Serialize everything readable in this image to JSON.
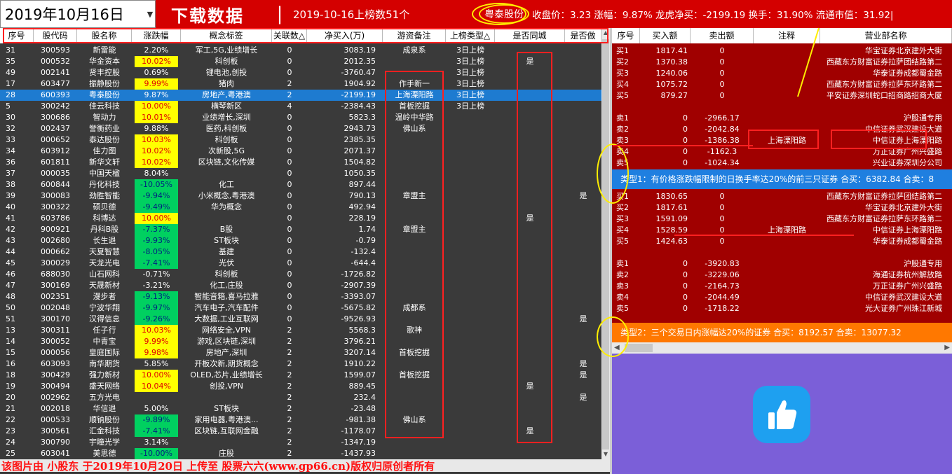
{
  "top": {
    "date": "2019年10月16日",
    "download_label": "下载数据",
    "separator": "|",
    "date_count": "2019-10-16上榜数51个",
    "separator2": "|",
    "stock_name": "粤泰股份",
    "quote": "收盘价：3.23 涨幅：9.87% 龙虎净买：-2199.19 换手：31.90% 流通市值：31.92|"
  },
  "left_table": {
    "headers": [
      "序号",
      "股代码",
      "股名称",
      "涨跌幅",
      "概念标签",
      "关联数△",
      "净买入(万)",
      "游资备注",
      "上榜类型△",
      "是否同城",
      "是否做"
    ],
    "rows": [
      {
        "seq": "31",
        "code": "300593",
        "name": "新雷能",
        "chg": "2.20%",
        "hl": "",
        "concept": "军工,5G,业绩增长",
        "link": "0",
        "net": "3083.19",
        "note": "成泉系",
        "type": "3日上榜",
        "city": "",
        "do": ""
      },
      {
        "seq": "35",
        "code": "000532",
        "name": "华金资本",
        "chg": "10.02%",
        "hl": "y",
        "concept": "科创板",
        "link": "0",
        "net": "2012.35",
        "note": "",
        "type": "3日上榜",
        "city": "是",
        "do": ""
      },
      {
        "seq": "49",
        "code": "002141",
        "name": "贤丰控股",
        "chg": "0.69%",
        "hl": "",
        "concept": "锂电池,创投",
        "link": "0",
        "net": "-3760.47",
        "note": "",
        "type": "3日上榜",
        "city": "",
        "do": ""
      },
      {
        "seq": "17",
        "code": "603477",
        "name": "振静股份",
        "chg": "9.99%",
        "hl": "y",
        "concept": "猪肉",
        "link": "2",
        "net": "1904.92",
        "note": "作手新一",
        "type": "3日上榜",
        "city": "",
        "do": ""
      },
      {
        "seq": "28",
        "code": "600393",
        "name": "粤泰股份",
        "chg": "9.87%",
        "hl": "",
        "concept": "房地产,粤港澳",
        "link": "2",
        "net": "-2199.19",
        "note": "上海溧阳路",
        "type": "3日上榜",
        "city": "",
        "do": "",
        "sel": true
      },
      {
        "seq": "5",
        "code": "300242",
        "name": "佳云科技",
        "chg": "10.00%",
        "hl": "y",
        "concept": "横琴新区",
        "link": "4",
        "net": "-2384.43",
        "note": "首板挖掘",
        "type": "3日上榜",
        "city": "",
        "do": ""
      },
      {
        "seq": "30",
        "code": "300686",
        "name": "智动力",
        "chg": "10.01%",
        "hl": "y",
        "concept": "业绩增长,深圳",
        "link": "0",
        "net": "5823.3",
        "note": "温岭中华路",
        "type": "",
        "city": "",
        "do": ""
      },
      {
        "seq": "32",
        "code": "002437",
        "name": "誉衡药业",
        "chg": "9.88%",
        "hl": "",
        "concept": "医药,科创板",
        "link": "0",
        "net": "2943.73",
        "note": "佛山系",
        "type": "",
        "city": "",
        "do": ""
      },
      {
        "seq": "33",
        "code": "000652",
        "name": "泰达股份",
        "chg": "10.03%",
        "hl": "y",
        "concept": "科创板",
        "link": "0",
        "net": "2385.35",
        "note": "",
        "type": "",
        "city": "",
        "do": ""
      },
      {
        "seq": "34",
        "code": "603912",
        "name": "佳力图",
        "chg": "10.02%",
        "hl": "y",
        "concept": "次新股,5G",
        "link": "0",
        "net": "2071.37",
        "note": "",
        "type": "",
        "city": "",
        "do": ""
      },
      {
        "seq": "36",
        "code": "601811",
        "name": "新华文轩",
        "chg": "10.02%",
        "hl": "y",
        "concept": "区块链,文化传媒",
        "link": "0",
        "net": "1504.82",
        "note": "",
        "type": "",
        "city": "",
        "do": ""
      },
      {
        "seq": "37",
        "code": "000035",
        "name": "中国天楹",
        "chg": "8.04%",
        "hl": "",
        "concept": "",
        "link": "0",
        "net": "1050.35",
        "note": "",
        "type": "",
        "city": "",
        "do": ""
      },
      {
        "seq": "38",
        "code": "600844",
        "name": "丹化科技",
        "chg": "-10.05%",
        "hl": "g",
        "concept": "化工",
        "link": "0",
        "net": "897.44",
        "note": "",
        "type": "",
        "city": "",
        "do": ""
      },
      {
        "seq": "39",
        "code": "300083",
        "name": "劲胜智能",
        "chg": "-9.94%",
        "hl": "g",
        "concept": "小米概念,粤港澳",
        "link": "0",
        "net": "790.13",
        "note": "章盟主",
        "type": "",
        "city": "",
        "do": "是"
      },
      {
        "seq": "40",
        "code": "300322",
        "name": "硕贝德",
        "chg": "-9.49%",
        "hl": "g",
        "concept": "华为概念",
        "link": "0",
        "net": "492.94",
        "note": "",
        "type": "",
        "city": "",
        "do": ""
      },
      {
        "seq": "41",
        "code": "603786",
        "name": "科博达",
        "chg": "10.00%",
        "hl": "y",
        "concept": "",
        "link": "0",
        "net": "228.19",
        "note": "",
        "type": "",
        "city": "是",
        "do": ""
      },
      {
        "seq": "42",
        "code": "900921",
        "name": "丹科B股",
        "chg": "-7.37%",
        "hl": "g",
        "concept": "B股",
        "link": "0",
        "net": "1.74",
        "note": "章盟主",
        "type": "",
        "city": "",
        "do": ""
      },
      {
        "seq": "43",
        "code": "002680",
        "name": "长生退",
        "chg": "-9.93%",
        "hl": "g",
        "concept": "ST板块",
        "link": "0",
        "net": "-0.79",
        "note": "",
        "type": "",
        "city": "",
        "do": ""
      },
      {
        "seq": "44",
        "code": "000662",
        "name": "天夏智慧",
        "chg": "-8.05%",
        "hl": "g",
        "concept": "基建",
        "link": "0",
        "net": "-132.4",
        "note": "",
        "type": "",
        "city": "",
        "do": ""
      },
      {
        "seq": "45",
        "code": "300029",
        "name": "天龙光电",
        "chg": "-7.41%",
        "hl": "g",
        "concept": "光伏",
        "link": "0",
        "net": "-644.4",
        "note": "",
        "type": "",
        "city": "",
        "do": ""
      },
      {
        "seq": "46",
        "code": "688030",
        "name": "山石网科",
        "chg": "-0.71%",
        "hl": "",
        "concept": "科创板",
        "link": "0",
        "net": "-1726.82",
        "note": "",
        "type": "",
        "city": "",
        "do": ""
      },
      {
        "seq": "47",
        "code": "300169",
        "name": "天晟新材",
        "chg": "-3.21%",
        "hl": "",
        "concept": "化工,庄股",
        "link": "0",
        "net": "-2907.39",
        "note": "",
        "type": "",
        "city": "",
        "do": ""
      },
      {
        "seq": "48",
        "code": "002351",
        "name": "漫步者",
        "chg": "-9.13%",
        "hl": "g",
        "concept": "智能音箱,喜马拉雅",
        "link": "0",
        "net": "-3393.07",
        "note": "",
        "type": "",
        "city": "",
        "do": ""
      },
      {
        "seq": "50",
        "code": "002048",
        "name": "宁波华翔",
        "chg": "-9.97%",
        "hl": "g",
        "concept": "汽车电子,汽车配件",
        "link": "0",
        "net": "-5675.82",
        "note": "成都系",
        "type": "",
        "city": "",
        "do": ""
      },
      {
        "seq": "51",
        "code": "300170",
        "name": "汉得信息",
        "chg": "-9.26%",
        "hl": "g",
        "concept": "大数据,工业互联网",
        "link": "0",
        "net": "-9526.93",
        "note": "",
        "type": "",
        "city": "",
        "do": "是"
      },
      {
        "seq": "13",
        "code": "300311",
        "name": "任子行",
        "chg": "10.03%",
        "hl": "y",
        "concept": "网络安全,VPN",
        "link": "2",
        "net": "5568.3",
        "note": "歌神",
        "type": "",
        "city": "",
        "do": ""
      },
      {
        "seq": "14",
        "code": "300052",
        "name": "中青宝",
        "chg": "9.99%",
        "hl": "y",
        "concept": "游戏,区块链,深圳",
        "link": "2",
        "net": "3796.21",
        "note": "",
        "type": "",
        "city": "",
        "do": ""
      },
      {
        "seq": "15",
        "code": "000056",
        "name": "皇庭国际",
        "chg": "9.98%",
        "hl": "y",
        "concept": "房地产,深圳",
        "link": "2",
        "net": "3207.14",
        "note": "首板挖掘",
        "type": "",
        "city": "",
        "do": ""
      },
      {
        "seq": "16",
        "code": "603093",
        "name": "南华期货",
        "chg": "5.85%",
        "hl": "",
        "concept": "开板次新,期货概念",
        "link": "2",
        "net": "1910.22",
        "note": "",
        "type": "",
        "city": "",
        "do": "是"
      },
      {
        "seq": "18",
        "code": "300429",
        "name": "强力新材",
        "chg": "10.00%",
        "hl": "y",
        "concept": "OLED,芯片,业绩增长",
        "link": "2",
        "net": "1599.07",
        "note": "首板挖掘",
        "type": "",
        "city": "",
        "do": "是"
      },
      {
        "seq": "19",
        "code": "300494",
        "name": "盛天网络",
        "chg": "10.04%",
        "hl": "y",
        "concept": "创投,VPN",
        "link": "2",
        "net": "889.45",
        "note": "",
        "type": "",
        "city": "是",
        "do": ""
      },
      {
        "seq": "20",
        "code": "002962",
        "name": "五方光电",
        "chg": "",
        "hl": "",
        "concept": "",
        "link": "2",
        "net": "232.4",
        "note": "",
        "type": "",
        "city": "",
        "do": "是"
      },
      {
        "seq": "21",
        "code": "002018",
        "name": "华信退",
        "chg": "5.00%",
        "hl": "",
        "concept": "ST板块",
        "link": "2",
        "net": "-23.48",
        "note": "",
        "type": "",
        "city": "",
        "do": ""
      },
      {
        "seq": "22",
        "code": "000533",
        "name": "顺钠股份",
        "chg": "-9.89%",
        "hl": "g",
        "concept": "家用电器,粤港澳...",
        "link": "2",
        "net": "-981.38",
        "note": "佛山系",
        "type": "",
        "city": "",
        "do": ""
      },
      {
        "seq": "23",
        "code": "300561",
        "name": "汇金科技",
        "chg": "-7.41%",
        "hl": "g",
        "concept": "区块链,互联网金融",
        "link": "2",
        "net": "-1178.07",
        "note": "",
        "type": "",
        "city": "是",
        "do": ""
      },
      {
        "seq": "24",
        "code": "300790",
        "name": "宇瞳光学",
        "chg": "3.14%",
        "hl": "",
        "concept": "",
        "link": "2",
        "net": "-1347.19",
        "note": "",
        "type": "",
        "city": "",
        "do": ""
      },
      {
        "seq": "25",
        "code": "603041",
        "name": "美思德",
        "chg": "-10.00%",
        "hl": "g",
        "concept": "庄股",
        "link": "2",
        "net": "-1437.93",
        "note": "",
        "type": "",
        "city": "",
        "do": ""
      }
    ]
  },
  "right_table": {
    "headers": [
      "序号",
      "买入额",
      "卖出额",
      "注释",
      "营业部名称"
    ],
    "group1": [
      {
        "seq": "买1",
        "buy": "1817.41",
        "sell": "0",
        "note": "",
        "dept": "华宝证券北京建外大街"
      },
      {
        "seq": "买2",
        "buy": "1370.38",
        "sell": "0",
        "note": "",
        "dept": "西藏东方财富证券拉萨团结路第二"
      },
      {
        "seq": "买3",
        "buy": "1240.06",
        "sell": "0",
        "note": "",
        "dept": "华泰证券成都蜀金路"
      },
      {
        "seq": "买4",
        "buy": "1075.72",
        "sell": "0",
        "note": "",
        "dept": "西藏东方财富证券拉萨东环路第二"
      },
      {
        "seq": "买5",
        "buy": "879.27",
        "sell": "0",
        "note": "",
        "dept": "平安证券深圳蛇口招商路招商大厦"
      }
    ],
    "group2": [
      {
        "seq": "卖1",
        "buy": "0",
        "sell": "-2966.17",
        "note": "",
        "dept": "沪股通专用"
      },
      {
        "seq": "卖2",
        "buy": "0",
        "sell": "-2042.84",
        "note": "",
        "dept": "中信证券武汉建设大道"
      },
      {
        "seq": "卖3",
        "buy": "0",
        "sell": "-1386.38",
        "note": "上海溧阳路",
        "dept": "中信证券上海溧阳路"
      },
      {
        "seq": "卖4",
        "buy": "0",
        "sell": "-1162.3",
        "note": "",
        "dept": "万正证券广州兴盛路"
      },
      {
        "seq": "卖5",
        "buy": "0",
        "sell": "-1024.34",
        "note": "",
        "dept": "兴业证券深圳分公司"
      }
    ],
    "band1": "类型1：有价格涨跌幅限制的日换手率达20%的前三只证券 合买：6382.84 合卖：8",
    "group3": [
      {
        "seq": "买1",
        "buy": "1830.65",
        "sell": "0",
        "note": "",
        "dept": "西藏东方财富证券拉萨团结路第二"
      },
      {
        "seq": "买2",
        "buy": "1817.61",
        "sell": "0",
        "note": "",
        "dept": "华宝证券北京建外大街"
      },
      {
        "seq": "买3",
        "buy": "1591.09",
        "sell": "0",
        "note": "",
        "dept": "西藏东方财富证券拉萨东环路第二"
      },
      {
        "seq": "买4",
        "buy": "1528.59",
        "sell": "0",
        "note": "上海溧阳路",
        "dept": "中信证券上海溧阳路"
      },
      {
        "seq": "买5",
        "buy": "1424.63",
        "sell": "0",
        "note": "",
        "dept": "华泰证券成都蜀金路"
      }
    ],
    "group4": [
      {
        "seq": "卖1",
        "buy": "0",
        "sell": "-3920.83",
        "note": "",
        "dept": "沪股通专用"
      },
      {
        "seq": "卖2",
        "buy": "0",
        "sell": "-3229.06",
        "note": "",
        "dept": "海通证券杭州解放路"
      },
      {
        "seq": "卖3",
        "buy": "0",
        "sell": "-2164.73",
        "note": "",
        "dept": "万正证券广州兴盛路"
      },
      {
        "seq": "卖4",
        "buy": "0",
        "sell": "-2044.49",
        "note": "",
        "dept": "中信证券武汉建设大道"
      },
      {
        "seq": "卖5",
        "buy": "0",
        "sell": "-1718.22",
        "note": "",
        "dept": "光大证券广州珠江新城"
      }
    ],
    "band2": "类型2：三个交易日内涨幅达20%的证券 合买：8192.57 合卖：13077.32"
  },
  "footer": {
    "watermark": "该图片由 小股东 于2019年10月20日 上传至 股票六六(www.gp66.cn)版权归原创者所有"
  },
  "colors": {
    "topbar": "#d40000",
    "selected_row": "#1e7bd0",
    "right_panel": "#a00000",
    "band1": "#1f7fe0",
    "band2": "#ff7800",
    "like_panel": "#7b5fd8"
  },
  "icons": [
    "chevron-down-icon",
    "thumbs-up-icon",
    "scroll-up-icon",
    "scroll-down-icon",
    "scroll-left-icon",
    "scroll-right-icon"
  ]
}
